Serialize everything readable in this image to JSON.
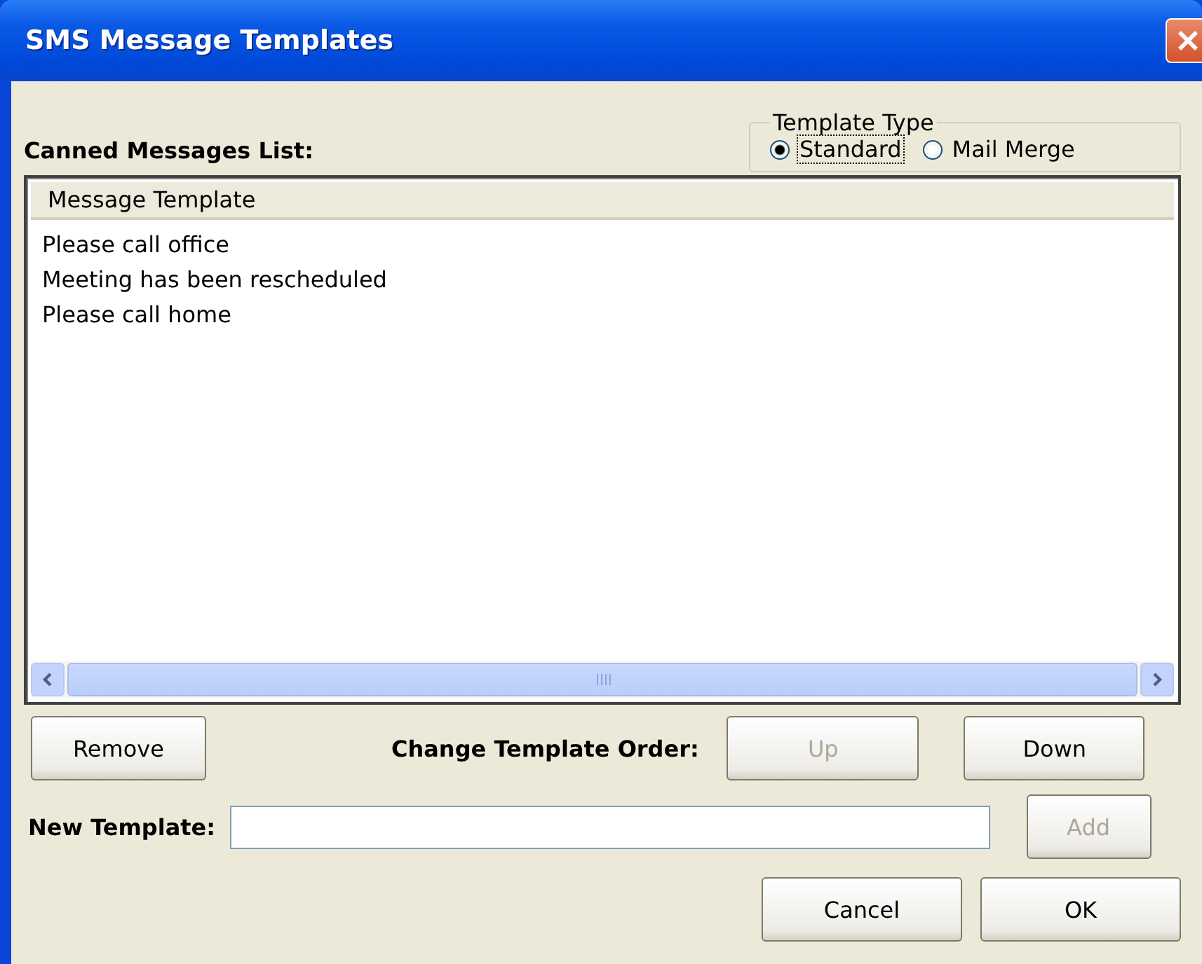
{
  "window": {
    "title": "SMS Message Templates"
  },
  "list_label": "Canned Messages List:",
  "template_type": {
    "legend": "Template Type",
    "options": [
      {
        "label": "Standard",
        "selected": true
      },
      {
        "label": "Mail Merge",
        "selected": false
      }
    ]
  },
  "list": {
    "column": "Message Template",
    "rows": [
      {
        "text": "Please call office"
      },
      {
        "text": "Meeting has been rescheduled"
      },
      {
        "text": "Please call home"
      }
    ]
  },
  "remove_button": {
    "label": "Remove",
    "disabled": false
  },
  "order_label": "Change Template Order:",
  "up_button": {
    "label": "Up",
    "disabled": true
  },
  "down_button": {
    "label": "Down",
    "disabled": false
  },
  "new_template": {
    "label": "New Template:"
  },
  "add_button": {
    "label": "Add",
    "disabled": true
  },
  "footer_buttons": [
    {
      "label": "Cancel",
      "disabled": false
    },
    {
      "label": "OK",
      "disabled": false
    }
  ]
}
